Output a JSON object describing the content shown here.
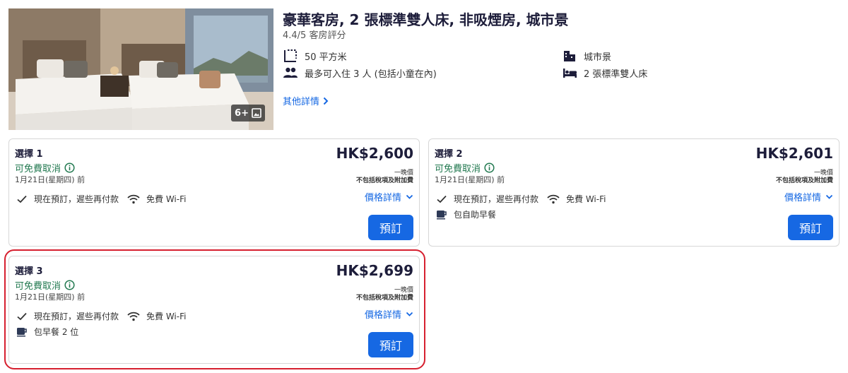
{
  "room": {
    "title": "豪華客房, 2 張標準雙人床, 非吸煙房, 城市景",
    "rating": "4.4/5 客房評分",
    "photo_badge": "6+",
    "features": {
      "size": "50 平方米",
      "view": "城市景",
      "occupancy": "最多可入住 3 人 (包括小童在內)",
      "beds": "2 張標準雙人床"
    },
    "more_details": "其他詳情"
  },
  "options": [
    {
      "title": "選擇 1",
      "cancellation": "可免費取消",
      "cancel_deadline": "1月21日(星期四) 前",
      "price": "HK$2,600",
      "per_night": "一晚價",
      "tax_note": "不包括稅項及附加費",
      "price_details": "價格詳情",
      "pay_later": "現在預訂，遲些再付款",
      "wifi": "免費 Wi-Fi",
      "breakfast": "",
      "reserve": "預訂"
    },
    {
      "title": "選擇 2",
      "cancellation": "可免費取消",
      "cancel_deadline": "1月21日(星期四) 前",
      "price": "HK$2,601",
      "per_night": "一晚價",
      "tax_note": "不包括稅項及附加費",
      "price_details": "價格詳情",
      "pay_later": "現在預訂，遲些再付款",
      "wifi": "免費 Wi-Fi",
      "breakfast": "包自助早餐",
      "reserve": "預訂"
    },
    {
      "title": "選擇 3",
      "cancellation": "可免費取消",
      "cancel_deadline": "1月21日(星期四) 前",
      "price": "HK$2,699",
      "per_night": "一晚價",
      "tax_note": "不包括稅項及附加費",
      "price_details": "價格詳情",
      "pay_later": "現在預訂，遲些再付款",
      "wifi": "免費 Wi-Fi",
      "breakfast": "包早餐 2 位",
      "reserve": "預訂"
    }
  ],
  "icons": {
    "size": "floor-plan-icon",
    "view": "city-icon",
    "occupancy": "people-icon",
    "beds": "bed-icon",
    "info": "info-icon",
    "check": "check-icon",
    "wifi": "wifi-icon",
    "breakfast": "coffee-cup-icon",
    "gallery": "gallery-icon",
    "chevron": "chevron-icon"
  },
  "colors": {
    "accent": "#1668e3",
    "free_cancel": "#227950",
    "highlight": "#d6202f"
  }
}
